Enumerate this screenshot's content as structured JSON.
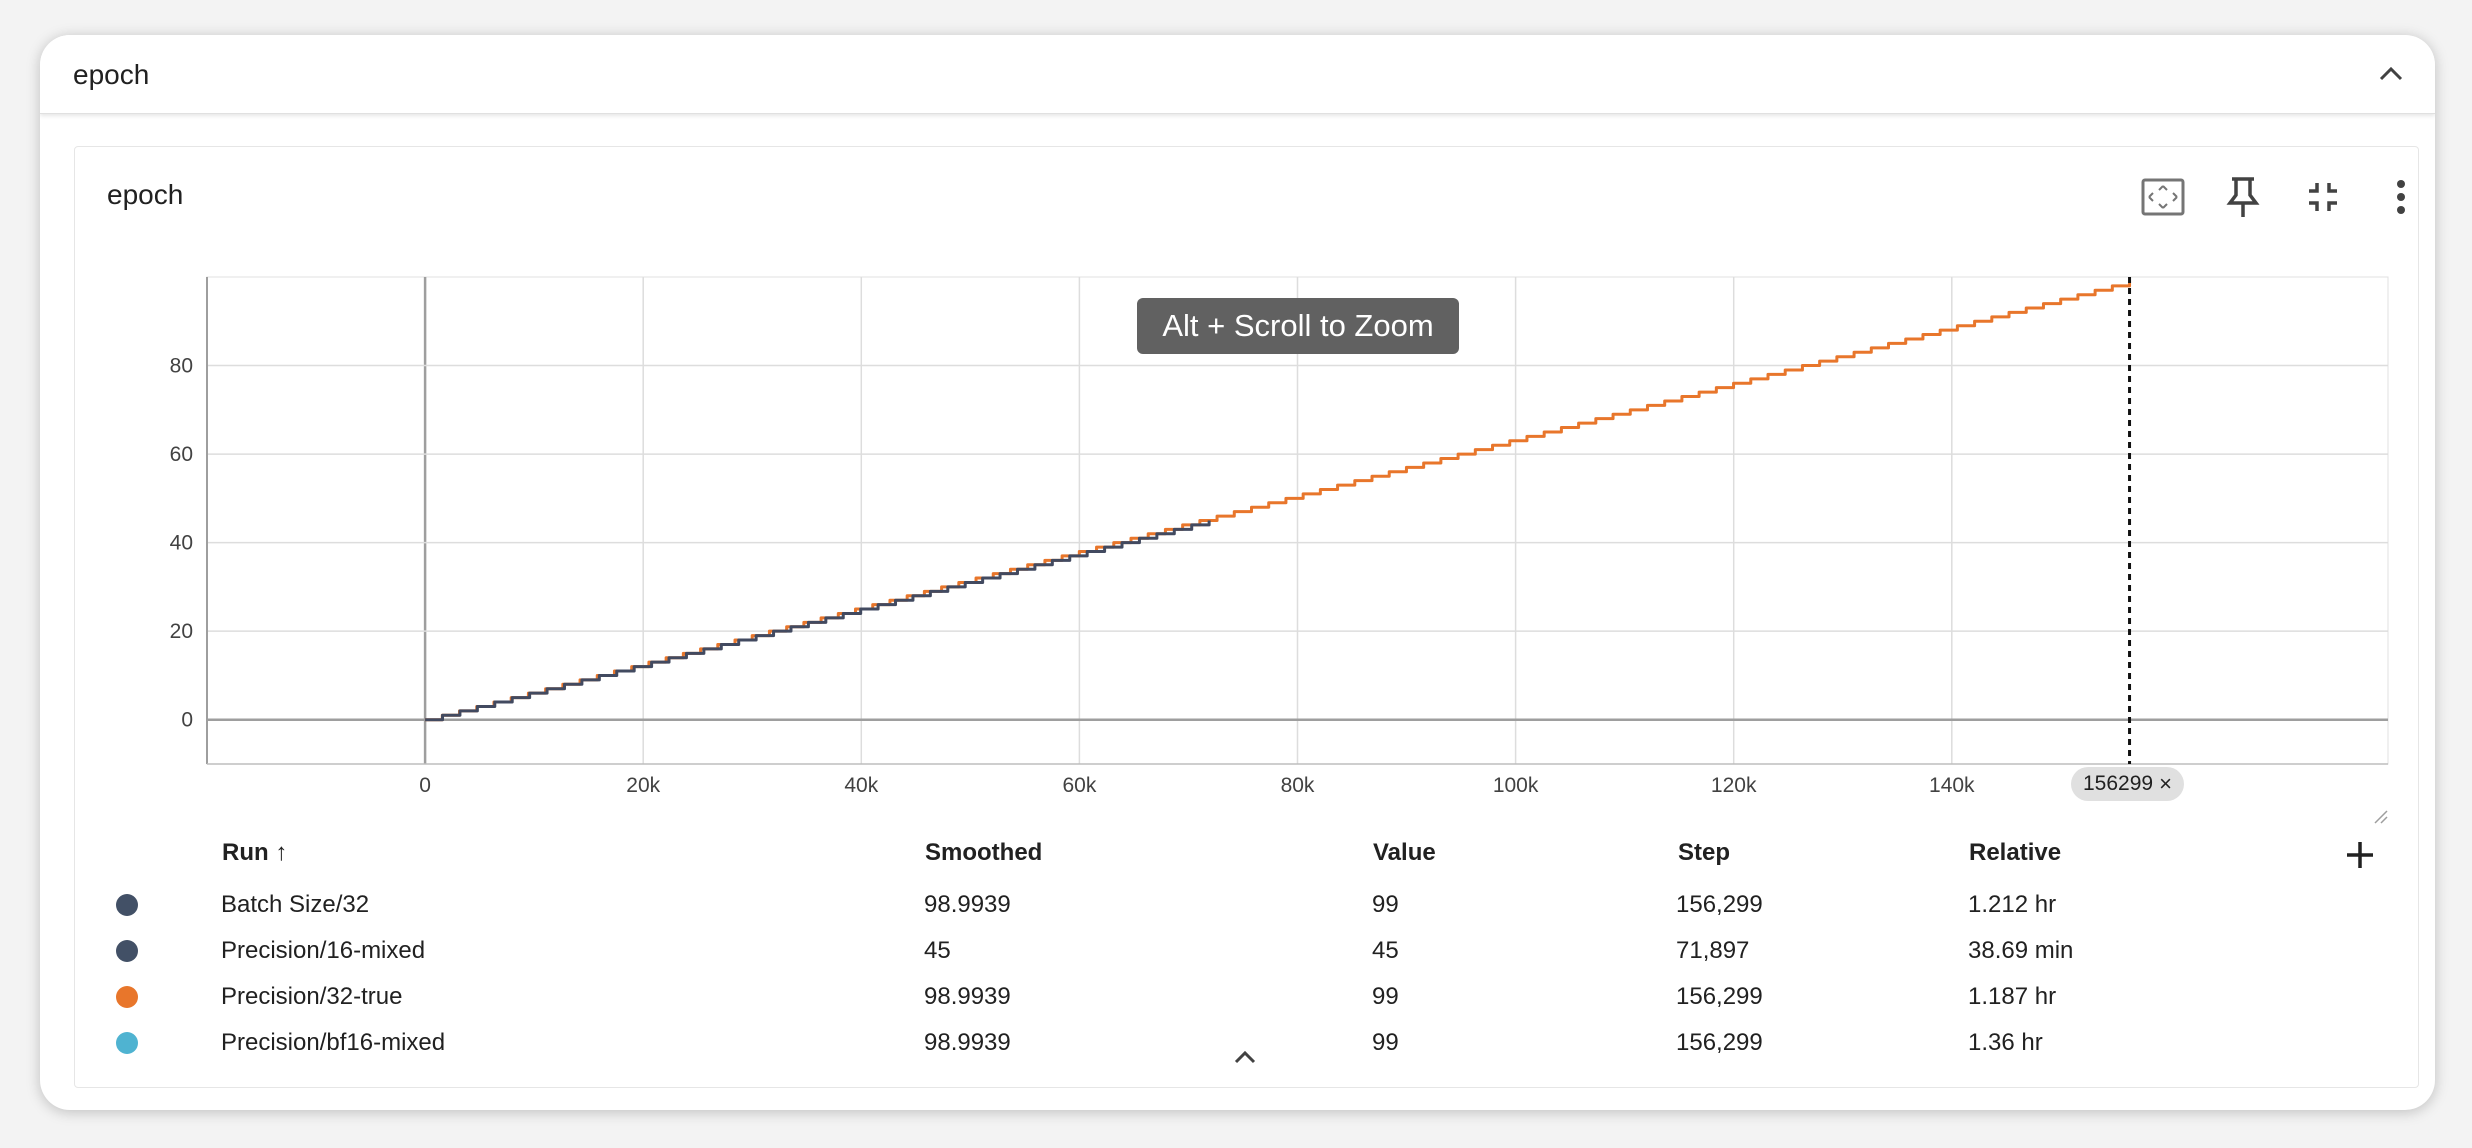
{
  "group": {
    "title": "epoch"
  },
  "card": {
    "title": "epoch"
  },
  "toolbar": {
    "fit_icon": "fit-to-data-icon",
    "pin_icon": "pin-icon",
    "collapse_icon": "collapse-icon",
    "more_icon": "more-vert-icon"
  },
  "zoom_hint": "Alt + Scroll to Zoom",
  "step_chip": {
    "value": "156299",
    "close": "×"
  },
  "chart_data": {
    "type": "line",
    "xlabel": "",
    "ylabel": "",
    "x_tick_labels": [
      "0",
      "20k",
      "40k",
      "60k",
      "80k",
      "100k",
      "120k",
      "140k"
    ],
    "y_tick_labels": [
      "0",
      "20",
      "40",
      "60",
      "80"
    ],
    "x_ticks": [
      0,
      20000,
      40000,
      60000,
      80000,
      100000,
      120000,
      140000
    ],
    "y_ticks": [
      0,
      20,
      40,
      60,
      80
    ],
    "xlim": [
      -20000,
      180000
    ],
    "ylim": [
      -10,
      100
    ],
    "grid": true,
    "legend": "table-below",
    "cursor_step": 156299,
    "series": [
      {
        "name": "Precision/32-true",
        "color": "#e8762b",
        "x": [
          0,
          156299
        ],
        "y": [
          0,
          99
        ]
      },
      {
        "name": "Precision/16-mixed",
        "color": "#424a60",
        "x": [
          0,
          71897
        ],
        "y": [
          0,
          45
        ]
      }
    ]
  },
  "table": {
    "headers": {
      "run": "Run ↑",
      "smoothed": "Smoothed",
      "value": "Value",
      "step": "Step",
      "relative": "Relative"
    },
    "rows": [
      {
        "run": "Batch Size/32",
        "color": "#425066",
        "smoothed": "98.9939",
        "value": "99",
        "step": "156,299",
        "relative": "1.212 hr"
      },
      {
        "run": "Precision/16-mixed",
        "color": "#425066",
        "smoothed": "45",
        "value": "45",
        "step": "71,897",
        "relative": "38.69 min"
      },
      {
        "run": "Precision/32-true",
        "color": "#e8762b",
        "smoothed": "98.9939",
        "value": "99",
        "step": "156,299",
        "relative": "1.187 hr"
      },
      {
        "run": "Precision/bf16-mixed",
        "color": "#4fb3d1",
        "smoothed": "98.9939",
        "value": "99",
        "step": "156,299",
        "relative": "1.36 hr"
      }
    ]
  }
}
